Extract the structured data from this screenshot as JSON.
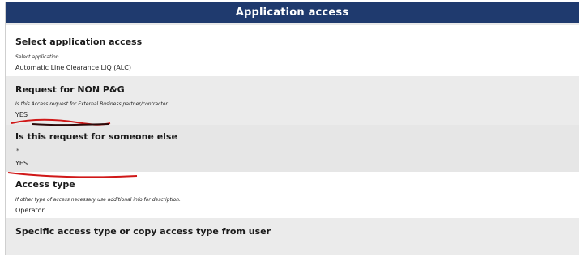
{
  "header": {
    "title": "Application access"
  },
  "sections": {
    "select_app": {
      "title": "Select application access",
      "hint": "Select application",
      "value": "Automatic Line Clearance LIQ (ALC)"
    },
    "non_pg": {
      "title": "Request for NON P&G",
      "hint": "Is this Access request for External Business partner/contractor",
      "value": "YES"
    },
    "someone_else": {
      "title": "Is this request for someone else",
      "required_marker": "*",
      "value": "YES"
    },
    "access_type": {
      "title": "Access type",
      "hint": "If other type of access necessary use additional info for description.",
      "value": "Operator"
    },
    "specific_access": {
      "title": "Specific access type or copy access type from user"
    }
  },
  "colors": {
    "header_bg": "#1f3a6e",
    "gray_row": "#ebebeb",
    "annotation_red": "#d01818"
  }
}
